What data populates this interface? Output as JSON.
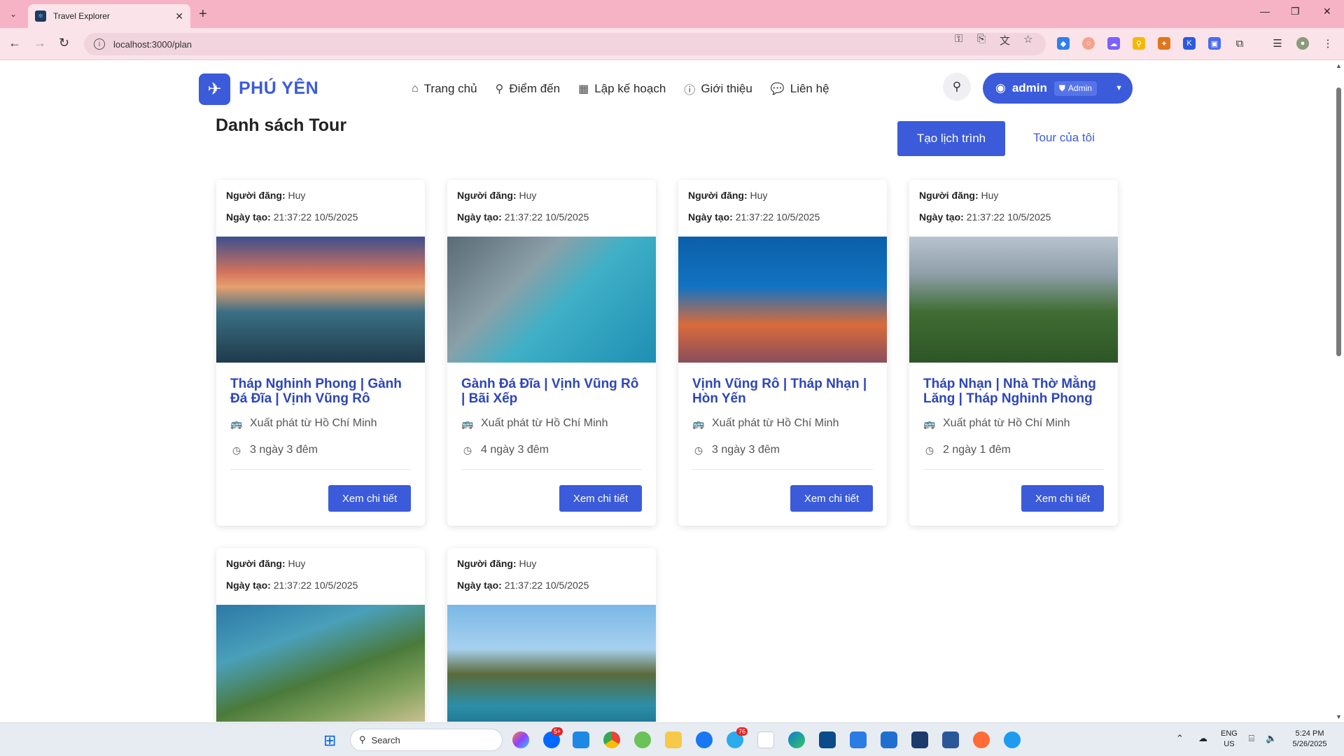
{
  "browser": {
    "tab_title": "Travel Explorer",
    "url": "localhost:3000/plan"
  },
  "header": {
    "logo_text": "PHÚ YÊN",
    "nav": [
      {
        "label": "Trang chủ",
        "icon": "home-icon"
      },
      {
        "label": "Điểm đến",
        "icon": "map-pin-icon"
      },
      {
        "label": "Lập kế hoạch",
        "icon": "calendar-icon"
      },
      {
        "label": "Giới thiệu",
        "icon": "info-icon"
      },
      {
        "label": "Liên hệ",
        "icon": "chat-icon"
      }
    ],
    "user_name": "admin",
    "user_role": "Admin"
  },
  "main": {
    "title": "Danh sách Tour",
    "create_label": "Tạo lịch trình",
    "my_tours_label": "Tour của tôi"
  },
  "labels": {
    "poster": "Người đăng:",
    "created": "Ngày tạo:",
    "detail_button": "Xem chi tiết"
  },
  "tours": [
    {
      "poster": "Huy",
      "created": "21:37:22 10/5/2025",
      "title": "Tháp Nghinh Phong | Gành Đá Đĩa | Vịnh Vũng Rô",
      "departure": "Xuất phát từ Hồ Chí Minh",
      "duration": "3 ngày 3 đêm"
    },
    {
      "poster": "Huy",
      "created": "21:37:22 10/5/2025",
      "title": "Gành Đá Đĩa | Vịnh Vũng Rô | Bãi Xếp",
      "departure": "Xuất phát từ Hồ Chí Minh",
      "duration": "4 ngày 3 đêm"
    },
    {
      "poster": "Huy",
      "created": "21:37:22 10/5/2025",
      "title": "Vịnh Vũng Rô | Tháp Nhạn | Hòn Yến",
      "departure": "Xuất phát từ Hồ Chí Minh",
      "duration": "3 ngày 3 đêm"
    },
    {
      "poster": "Huy",
      "created": "21:37:22 10/5/2025",
      "title": "Tháp Nhạn | Nhà Thờ Mằng Lăng | Tháp Nghinh Phong",
      "departure": "Xuất phát từ Hồ Chí Minh",
      "duration": "2 ngày 1 đêm"
    },
    {
      "poster": "Huy",
      "created": "21:37:22 10/5/2025"
    },
    {
      "poster": "Huy",
      "created": "21:37:22 10/5/2025"
    }
  ],
  "taskbar": {
    "search_placeholder": "Search",
    "lang_top": "ENG",
    "lang_bottom": "US",
    "time": "5:24 PM",
    "date": "5/26/2025",
    "zalo_badge": "5+",
    "telegram_badge": "76"
  },
  "colors": {
    "accent": "#3b5bdb",
    "tab_bar": "#f7b3c6",
    "toolbar": "#fbe3ea"
  }
}
